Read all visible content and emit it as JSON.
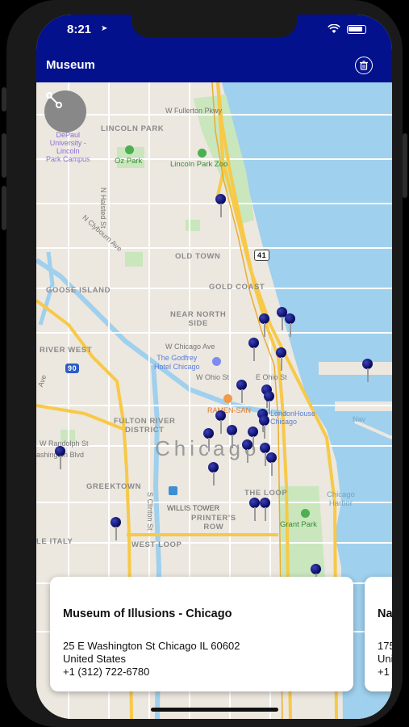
{
  "status_bar": {
    "time": "8:21",
    "location_glyph": "➤"
  },
  "nav": {
    "title": "Museum",
    "trash_icon": "trash-icon"
  },
  "map": {
    "route_icon": "route-icon",
    "labels": {
      "fullerton": "W Fullerton Pkwy",
      "lincoln_park": "LINCOLN PARK",
      "depaul": "DePaul\nUniversity -\nLincoln\nPark Campus",
      "oz_park": "Oz Park",
      "lincoln_zoo": "Lincoln Park Zoo",
      "halsted": "N Halsted St",
      "clybourn": "N Clybourn Ave",
      "old_town": "OLD TOWN",
      "hwy41": "41",
      "gold_coast": "GOLD COAST",
      "goose_island": "GOOSE ISLAND",
      "near_north": "NEAR NORTH\nSIDE",
      "river_west": "RIVER WEST",
      "chicago_ave": "W Chicago Ave",
      "godfrey": "The Godfrey\nHotel Chicago",
      "i90": "90",
      "ohio_w": "W Ohio St",
      "ohio_e": "E Ohio St",
      "ramen": "RAMEN-SAN",
      "london": "LondonHouse\nChicago",
      "fulton": "FULTON RIVER\nDISTRICT",
      "randolph": "W Randolph St",
      "washington": "ashington Blvd",
      "chicago": "Chicago",
      "greektown": "GREEKTOWN",
      "willis": "WILLIS TOWER",
      "loop": "THE LOOP",
      "printers": "PRINTER'S\nROW",
      "clinton": "S Clinton St",
      "chicago_harbor": "Chicago\nHarbor",
      "grant_park": "Grant Park",
      "italy": "LE ITALY",
      "west_loop": "WEST LOOP",
      "ave": "Ave",
      "nav": "Nav"
    }
  },
  "cards": [
    {
      "title": "Museum of Illusions - Chicago",
      "address_line1": "25 E Washington St Chicago IL 60602",
      "address_line2": "United States",
      "phone": "+1 (312) 722-6780"
    },
    {
      "title": "Na",
      "address_line1": "175",
      "address_line2": "Uni",
      "phone": "+1"
    }
  ]
}
